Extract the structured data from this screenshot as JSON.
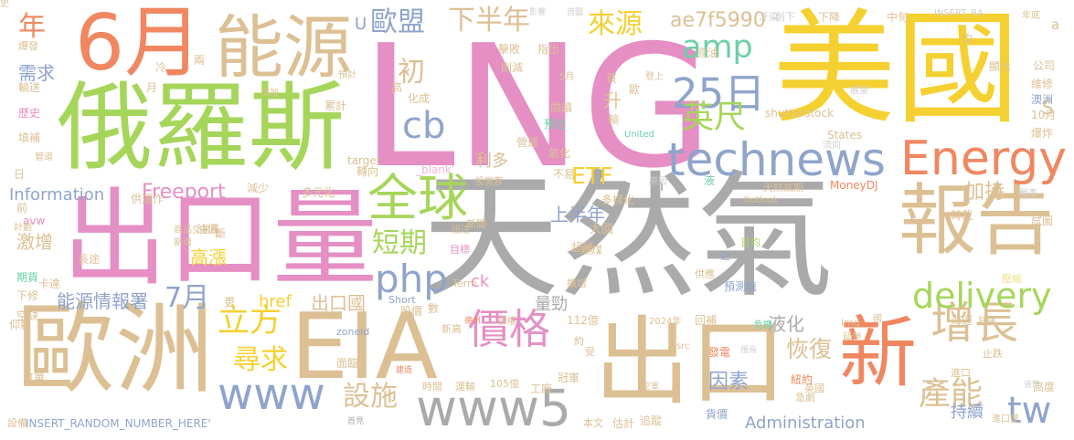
{
  "colors": {
    "gray": "#aaaaaa",
    "pink": "#e58fc4",
    "yellow": "#f5d031",
    "green": "#a5d65a",
    "blue": "#8fa4cb",
    "orange": "#f08760",
    "tan": "#dcc094",
    "teal": "#6ccfa7",
    "lightyellow": "#f1de8a",
    "lightpink": "#efb5d7",
    "lightgray": "#cfcfcf",
    "lightblue": "#b7c6df",
    "lightgreen": "#c5e39c"
  },
  "words": [
    {
      "text": "LNG"
    },
    {
      "text": "天然氣"
    },
    {
      "text": "美國"
    },
    {
      "text": "俄羅斯"
    },
    {
      "text": "出口量"
    },
    {
      "text": "歐洲"
    },
    {
      "text": "出口"
    },
    {
      "text": "能源"
    },
    {
      "text": "6月"
    },
    {
      "text": "EIA"
    },
    {
      "text": "報告"
    },
    {
      "text": "新"
    },
    {
      "text": "technews"
    },
    {
      "text": "Energy"
    },
    {
      "text": "全球"
    },
    {
      "text": "www"
    },
    {
      "text": "www5"
    },
    {
      "text": "增長"
    },
    {
      "text": "價格"
    },
    {
      "text": "delivery"
    },
    {
      "text": "25日"
    },
    {
      "text": "php"
    },
    {
      "text": "cb"
    },
    {
      "text": "amp"
    },
    {
      "text": "英尺"
    },
    {
      "text": "tw"
    },
    {
      "text": "歐盟"
    },
    {
      "text": "下半年"
    },
    {
      "text": "來源"
    },
    {
      "text": "短期"
    },
    {
      "text": "立方"
    },
    {
      "text": "尋求"
    },
    {
      "text": "設施"
    },
    {
      "text": "產能"
    },
    {
      "text": "ae7f5990"
    },
    {
      "text": "7月"
    },
    {
      "text": "Freeport"
    },
    {
      "text": "恢復"
    },
    {
      "text": "初"
    },
    {
      "text": "年"
    },
    {
      "text": "需求"
    },
    {
      "text": "Information"
    },
    {
      "text": "Administration"
    },
    {
      "text": "ETF"
    },
    {
      "text": "加持"
    },
    {
      "text": "能源情報署"
    },
    {
      "text": "出口國"
    },
    {
      "text": "激增"
    },
    {
      "text": "上半年"
    },
    {
      "text": "高漲"
    },
    {
      "text": "液化"
    },
    {
      "text": "因素"
    },
    {
      "text": "利多"
    },
    {
      "text": "量勁"
    },
    {
      "text": "href"
    },
    {
      "text": "ck"
    },
    {
      "text": "升"
    },
    {
      "text": "S"
    },
    {
      "text": "n"
    },
    {
      "text": "U"
    },
    {
      "text": "a"
    },
    {
      "text": "持續"
    },
    {
      "text": "INSERT_RANDOM_NUMBER_HERE'"
    },
    {
      "text": "INSERT_RA"
    },
    {
      "text": "年底"
    },
    {
      "text": "爆發"
    },
    {
      "text": "設備"
    },
    {
      "text": "首見"
    },
    {
      "text": "本文"
    },
    {
      "text": "估計"
    },
    {
      "text": "追蹤"
    },
    {
      "text": "進口量"
    },
    {
      "text": "工廠"
    },
    {
      "text": "冠軍"
    },
    {
      "text": "105億"
    },
    {
      "text": "運輸"
    },
    {
      "text": "時間"
    },
    {
      "text": "建造"
    },
    {
      "text": "空軍"
    },
    {
      "text": "貨價"
    },
    {
      "text": "急劇"
    },
    {
      "text": "英國"
    },
    {
      "text": "紐約"
    },
    {
      "text": "進口"
    },
    {
      "text": "高度"
    },
    {
      "text": "液態"
    },
    {
      "text": "止跌"
    },
    {
      "text": "海運"
    },
    {
      "text": "發電"
    },
    {
      "text": "俄烏"
    },
    {
      "text": "回補"
    },
    {
      "text": "危機"
    },
    {
      "text": "img"
    },
    {
      "text": "國"
    },
    {
      "text": "狂飆"
    },
    {
      "text": "2024年"
    },
    {
      "text": "112億"
    },
    {
      "text": "zoneid"
    },
    {
      "text": "面臨"
    },
    {
      "text": "新高"
    },
    {
      "text": "德州"
    },
    {
      "text": "授權"
    },
    {
      "text": "股價"
    },
    {
      "text": "數"
    },
    {
      "text": "約"
    },
    {
      "text": "受"
    },
    {
      "text": "src"
    },
    {
      "text": "延伸"
    },
    {
      "text": "近"
    },
    {
      "text": "預測值"
    },
    {
      "text": "壓縮"
    },
    {
      "text": "Short"
    },
    {
      "text": "Term"
    },
    {
      "text": "目標"
    },
    {
      "text": "超越"
    },
    {
      "text": "擴增"
    },
    {
      "text": "供應"
    },
    {
      "text": "日均"
    },
    {
      "text": "大國"
    },
    {
      "text": "燃煤"
    },
    {
      "text": "扭注"
    },
    {
      "text": "新聞"
    },
    {
      "text": "多樣化"
    },
    {
      "text": "原因"
    },
    {
      "text": "MoneyDJ"
    },
    {
      "text": "Outlook"
    },
    {
      "text": "轉載"
    },
    {
      "text": "試圖"
    },
    {
      "text": "戰事"
    },
    {
      "text": "投機客"
    },
    {
      "text": "天然氣期"
    },
    {
      "text": "液"
    },
    {
      "text": "_blank'"
    },
    {
      "text": "target"
    },
    {
      "text": "轉向"
    },
    {
      "text": "不易"
    },
    {
      "text": "氣化"
    },
    {
      "text": "流向"
    },
    {
      "text": "United"
    },
    {
      "text": "States"
    },
    {
      "text": "輸"
    },
    {
      "text": "預估"
    },
    {
      "text": "營運"
    },
    {
      "text": "高"
    },
    {
      "text": "化成"
    },
    {
      "text": "預計"
    },
    {
      "text": "累計"
    },
    {
      "text": "增加"
    },
    {
      "text": "月"
    },
    {
      "text": "兩"
    },
    {
      "text": "冷"
    },
    {
      "text": "輸送"
    },
    {
      "text": "歷史"
    },
    {
      "text": "填補"
    },
    {
      "text": "管道"
    },
    {
      "text": "日"
    },
    {
      "text": "供運作"
    },
    {
      "text": "前"
    },
    {
      "text": "avw"
    },
    {
      "text": "計劃"
    },
    {
      "text": "商品交易所"
    },
    {
      "text": "油價"
    },
    {
      "text": "斷"
    },
    {
      "text": "新增"
    },
    {
      "text": "期貨"
    },
    {
      "text": "卡達"
    },
    {
      "text": "下修"
    },
    {
      "text": "空缺"
    },
    {
      "text": "長途"
    },
    {
      "text": "更"
    },
    {
      "text": "仰賴"
    },
    {
      "text": "訂單"
    },
    {
      "text": "減少"
    },
    {
      "text": "多元化"
    },
    {
      "text": "擊敗"
    },
    {
      "text": "指出"
    },
    {
      "text": "削減"
    },
    {
      "text": "5月"
    },
    {
      "text": "買"
    },
    {
      "text": "歐"
    },
    {
      "text": "登上"
    },
    {
      "text": "原油"
    },
    {
      "text": "汙染"
    },
    {
      "text": "創下"
    },
    {
      "text": "下降"
    },
    {
      "text": "中旬"
    },
    {
      "text": "均"
    },
    {
      "text": "公司"
    },
    {
      "text": "維修"
    },
    {
      "text": "澳洲"
    },
    {
      "text": "10月"
    },
    {
      "text": "爆炸"
    },
    {
      "text": "顯示"
    },
    {
      "text": "展望"
    },
    {
      "text": "shutterstock"
    },
    {
      "text": "影響"
    },
    {
      "text": "首圖"
    },
    {
      "text": "閱讀"
    },
    {
      "text": "史"
    }
  ]
}
